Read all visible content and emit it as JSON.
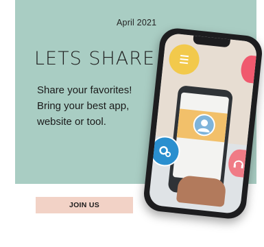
{
  "date": "April 2021",
  "headline": "LETS SHARE",
  "body_lines": [
    "Share your favorites!",
    "Bring your best app,",
    "website or tool."
  ],
  "join_label": "JOIN US",
  "icons": {
    "phone": "smartphone-icon",
    "list": "list-icon",
    "gears": "gears-icon",
    "avatar": "user-avatar-icon",
    "headphones": "headphones-icon"
  },
  "colors": {
    "teal": "#a9cdc3",
    "join_bg": "#f2d2c6"
  }
}
